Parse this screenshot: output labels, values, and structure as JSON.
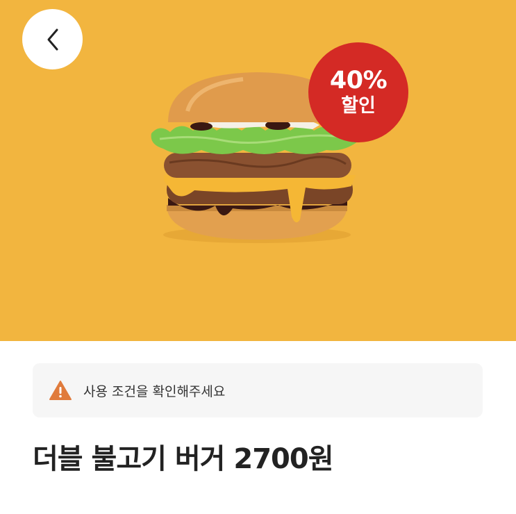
{
  "colors": {
    "hero_background": "#f2b53f",
    "badge_background": "#d42a25",
    "warning_icon": "#e07b3c"
  },
  "header": {
    "back_icon": "chevron-left-icon"
  },
  "promo": {
    "badge_percent": "40%",
    "badge_text": "할인"
  },
  "notice": {
    "icon": "warning-icon",
    "text": "사용 조건을 확인해주세요"
  },
  "product": {
    "title": "더블 불고기 버거 2700원"
  }
}
